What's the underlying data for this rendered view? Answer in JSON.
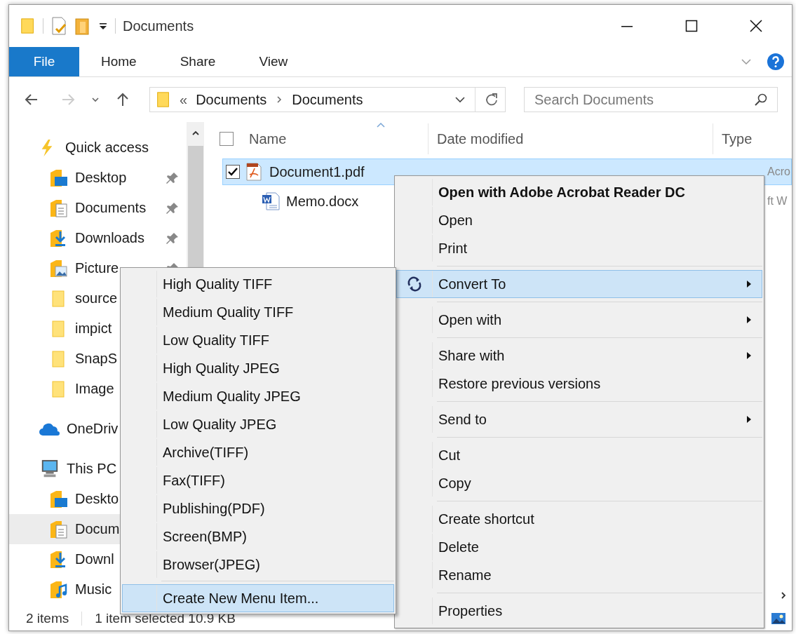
{
  "window": {
    "title": "Documents"
  },
  "ribbon_tabs": [
    {
      "label": "File",
      "kind": "file"
    },
    {
      "label": "Home",
      "kind": "tab"
    },
    {
      "label": "Share",
      "kind": "tab"
    },
    {
      "label": "View",
      "kind": "tab"
    }
  ],
  "address": {
    "overflow": "«",
    "path": [
      "Documents",
      "Documents"
    ]
  },
  "search": {
    "placeholder": "Search Documents"
  },
  "nav": [
    {
      "label": "Quick access",
      "kind": "quick",
      "selected": false,
      "children": [
        {
          "label": "Desktop",
          "kind": "desktop",
          "pinned": true,
          "selected": false
        },
        {
          "label": "Documents",
          "kind": "documents",
          "pinned": true,
          "selected": false
        },
        {
          "label": "Downloads",
          "kind": "downloads",
          "pinned": true,
          "selected": false
        },
        {
          "label": "Picture",
          "kind": "pictures",
          "pinned": true,
          "selected": false
        },
        {
          "label": "source",
          "kind": "folder",
          "selected": false
        },
        {
          "label": "impict",
          "kind": "folder",
          "selected": false
        },
        {
          "label": "SnapS",
          "kind": "folder",
          "selected": false
        },
        {
          "label": "Image",
          "kind": "folder",
          "selected": false
        }
      ]
    },
    {
      "label": "OneDriv",
      "kind": "cloud",
      "selected": false
    },
    {
      "label": "This PC",
      "kind": "pc",
      "selected": false,
      "children": [
        {
          "label": "Deskto",
          "kind": "desktop",
          "selected": false
        },
        {
          "label": "Docum",
          "kind": "documents",
          "selected": true
        },
        {
          "label": "Downl",
          "kind": "downloads",
          "selected": false
        },
        {
          "label": "Music",
          "kind": "music",
          "selected": false
        }
      ]
    }
  ],
  "file_list": {
    "header": {
      "checked": false,
      "columns": [
        "Name",
        "Date modified",
        "Type"
      ]
    },
    "rows": [
      {
        "name": "Document1.pdf",
        "kind": "pdf",
        "checked": true,
        "selected": true,
        "type": "Acro"
      },
      {
        "name": "Memo.docx",
        "kind": "word",
        "checked": false,
        "selected": false,
        "type": "ft W"
      }
    ]
  },
  "status_bar": {
    "count": "2 items",
    "selection": "1 item selected 10.9 KB"
  },
  "context_menu": [
    {
      "kind": "item",
      "label": "Open with Adobe Acrobat Reader DC",
      "bold": true,
      "highlighted": false,
      "submenu": false
    },
    {
      "kind": "item",
      "label": "Open",
      "bold": false,
      "highlighted": false,
      "submenu": false
    },
    {
      "kind": "item",
      "label": "Print",
      "bold": false,
      "highlighted": false,
      "submenu": false
    },
    {
      "kind": "separator"
    },
    {
      "kind": "icon_item",
      "label": "Convert To",
      "bold": false,
      "highlighted": true,
      "submenu": true
    },
    {
      "kind": "separator"
    },
    {
      "kind": "item",
      "label": "Open with",
      "bold": false,
      "highlighted": false,
      "submenu": true
    },
    {
      "kind": "separator"
    },
    {
      "kind": "item",
      "label": "Share with",
      "bold": false,
      "highlighted": false,
      "submenu": true
    },
    {
      "kind": "item",
      "label": "Restore previous versions",
      "bold": false,
      "highlighted": false,
      "submenu": false
    },
    {
      "kind": "separator"
    },
    {
      "kind": "item",
      "label": "Send to",
      "bold": false,
      "highlighted": false,
      "submenu": true
    },
    {
      "kind": "separator"
    },
    {
      "kind": "item",
      "label": "Cut",
      "bold": false,
      "highlighted": false,
      "submenu": false
    },
    {
      "kind": "item",
      "label": "Copy",
      "bold": false,
      "highlighted": false,
      "submenu": false
    },
    {
      "kind": "separator"
    },
    {
      "kind": "item",
      "label": "Create shortcut",
      "bold": false,
      "highlighted": false,
      "submenu": false
    },
    {
      "kind": "item",
      "label": "Delete",
      "bold": false,
      "highlighted": false,
      "submenu": false
    },
    {
      "kind": "item",
      "label": "Rename",
      "bold": false,
      "highlighted": false,
      "submenu": false
    },
    {
      "kind": "separator"
    },
    {
      "kind": "item",
      "label": "Properties",
      "bold": false,
      "highlighted": false,
      "submenu": false
    }
  ],
  "submenu": [
    {
      "kind": "item",
      "label": "High Quality TIFF",
      "highlighted": false
    },
    {
      "kind": "item",
      "label": "Medium Quality TIFF",
      "highlighted": false
    },
    {
      "kind": "item",
      "label": "Low Quality TIFF",
      "highlighted": false
    },
    {
      "kind": "item",
      "label": "High Quality JPEG",
      "highlighted": false
    },
    {
      "kind": "item",
      "label": "Medium Quality JPEG",
      "highlighted": false
    },
    {
      "kind": "item",
      "label": "Low Quality JPEG",
      "highlighted": false
    },
    {
      "kind": "item",
      "label": "Archive(TIFF)",
      "highlighted": false
    },
    {
      "kind": "item",
      "label": "Fax(TIFF)",
      "highlighted": false
    },
    {
      "kind": "item",
      "label": "Publishing(PDF)",
      "highlighted": false
    },
    {
      "kind": "item",
      "label": "Screen(BMP)",
      "highlighted": false
    },
    {
      "kind": "item",
      "label": "Browser(JPEG)",
      "highlighted": false
    },
    {
      "kind": "separator"
    },
    {
      "kind": "item",
      "label": "Create New Menu Item...",
      "highlighted": true
    }
  ]
}
